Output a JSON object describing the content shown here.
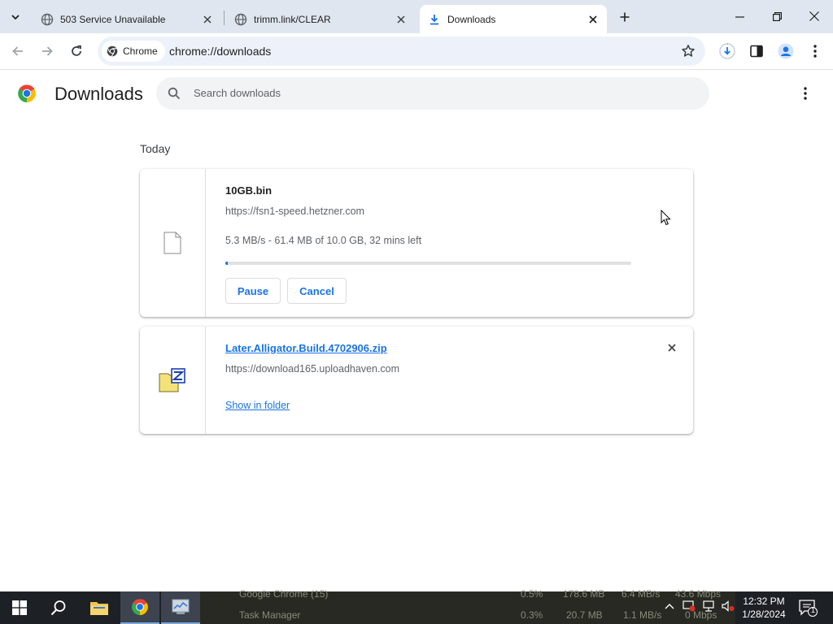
{
  "tabs": [
    {
      "title": "503 Service Unavailable",
      "icon": "globe-icon"
    },
    {
      "title": "trimm.link/CLEAR",
      "icon": "globe-icon"
    },
    {
      "title": "Downloads",
      "icon": "download-icon",
      "active": true
    }
  ],
  "toolbar": {
    "chip_label": "Chrome",
    "url": "chrome://downloads"
  },
  "page": {
    "title": "Downloads",
    "search_placeholder": "Search downloads",
    "date_label": "Today"
  },
  "downloads": [
    {
      "filename": "10GB.bin",
      "source": "https://fsn1-speed.hetzner.com",
      "status": "5.3 MB/s - 61.4 MB of 10.0 GB, 32 mins left",
      "progress_fraction": 0.006,
      "pause_label": "Pause",
      "cancel_label": "Cancel"
    },
    {
      "filename": "Later.Alligator.Build.4702906.zip",
      "source": "https://download165.uploadhaven.com",
      "show_in_folder_label": "Show in folder"
    }
  ],
  "taskbar": {
    "ghost_rows": [
      {
        "name": "Google Chrome (15)",
        "cpu": "0.5%",
        "mem": "178.6 MB",
        "disk": "6.4 MB/s",
        "net": "43.6 Mbps"
      },
      {
        "name": "Task Manager",
        "cpu": "0.3%",
        "mem": "20.7 MB",
        "disk": "1.1 MB/s",
        "net": "0 Mbps"
      }
    ],
    "time": "12:32 PM",
    "date": "1/28/2024",
    "notification_count": "1"
  },
  "colors": {
    "accent": "#1a73e8",
    "tabstrip": "#dfe6ef",
    "taskbar": "#1d2126"
  }
}
